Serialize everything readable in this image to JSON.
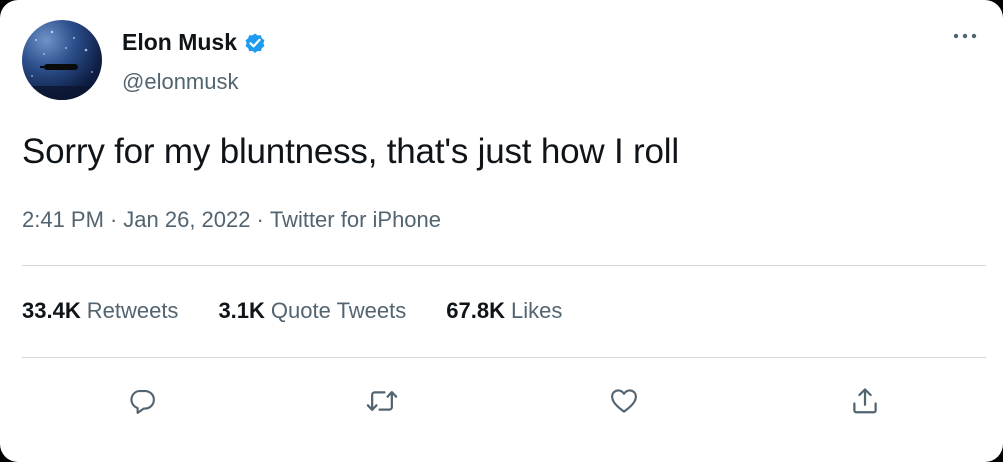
{
  "author": {
    "name": "Elon Musk",
    "handle": "@elonmusk",
    "verified_color": "#1d9bf0"
  },
  "tweet": {
    "text": "Sorry for my bluntness, that's just how I roll"
  },
  "meta": {
    "time": "2:41 PM",
    "date": "Jan 26, 2022",
    "source": "Twitter for iPhone",
    "separator": "·"
  },
  "stats": [
    {
      "count": "33.4K",
      "label": "Retweets"
    },
    {
      "count": "3.1K",
      "label": "Quote Tweets"
    },
    {
      "count": "67.8K",
      "label": "Likes"
    }
  ],
  "actions": {
    "reply_icon": "reply-icon",
    "retweet_icon": "retweet-icon",
    "like_icon": "heart-icon",
    "share_icon": "share-icon"
  },
  "colors": {
    "text_primary": "#0f1419",
    "text_secondary": "#536471",
    "divider": "#cfd9de"
  }
}
